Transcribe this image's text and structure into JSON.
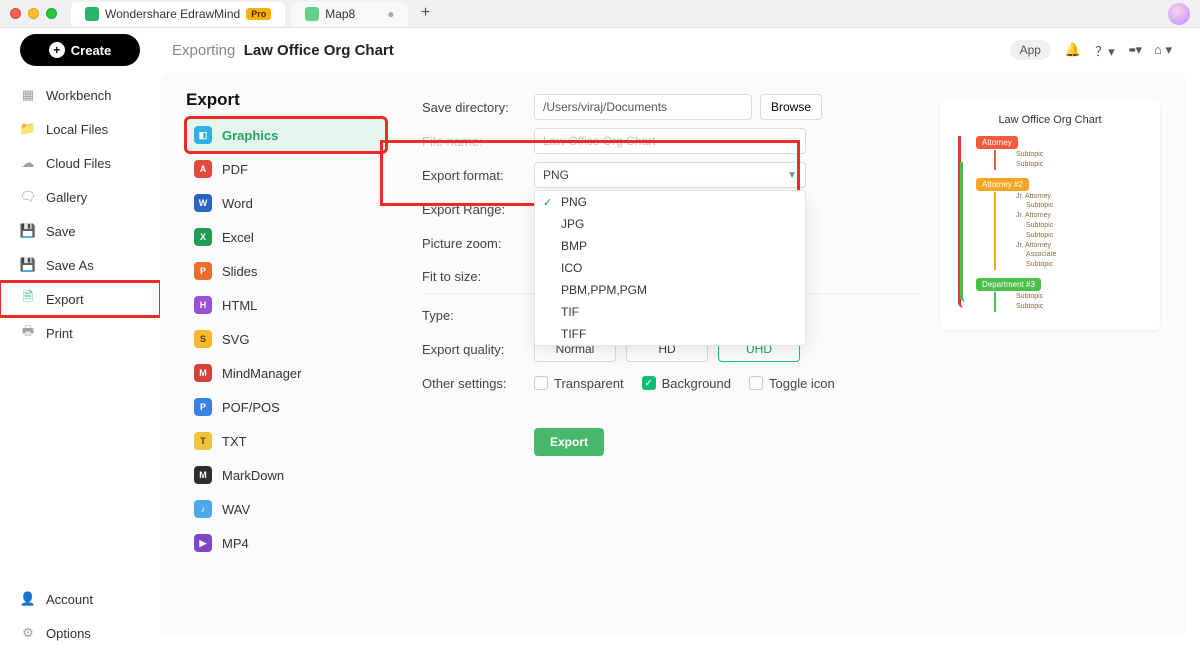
{
  "titlebar": {
    "app_name": "Wondershare EdrawMind",
    "badge": "Pro",
    "tab2": "Map8"
  },
  "header": {
    "create": "Create",
    "crumb_prefix": "Exporting",
    "crumb_title": "Law Office Org Chart",
    "app_chip": "App"
  },
  "nav": {
    "workbench": "Workbench",
    "localfiles": "Local Files",
    "cloudfiles": "Cloud Files",
    "gallery": "Gallery",
    "save": "Save",
    "saveas": "Save As",
    "export": "Export",
    "print": "Print",
    "account": "Account",
    "options": "Options"
  },
  "export": {
    "heading": "Export",
    "formats": {
      "graphics": "Graphics",
      "pdf": "PDF",
      "word": "Word",
      "excel": "Excel",
      "slides": "Slides",
      "html": "HTML",
      "svg": "SVG",
      "mindmanager": "MindManager",
      "pofpos": "POF/POS",
      "txt": "TXT",
      "markdown": "MarkDown",
      "wav": "WAV",
      "mp4": "MP4"
    }
  },
  "form": {
    "save_dir_label": "Save directory:",
    "save_dir_value": "/Users/viraj/Documents",
    "browse": "Browse",
    "file_name_label": "File name:",
    "file_name_value": "Law Office Org Chart",
    "export_format_label": "Export format:",
    "export_format_value": "PNG",
    "format_options": [
      "PNG",
      "JPG",
      "BMP",
      "ICO",
      "PBM,PPM,PGM",
      "TIF",
      "TIFF"
    ],
    "export_range_label": "Export Range:",
    "picture_zoom_label": "Picture zoom:",
    "fit_to_size_label": "Fit to size:",
    "type_label": "Type:",
    "quality_label": "Export quality:",
    "quality_options": [
      "Normal",
      "HD",
      "UHD"
    ],
    "other_settings_label": "Other settings:",
    "transparent": "Transparent",
    "background": "Background",
    "toggle_icon": "Toggle icon",
    "export_btn": "Export"
  },
  "preview": {
    "title": "Law Office Org Chart",
    "nodes": {
      "n1": "Attorney",
      "n2": "Attorney #2",
      "n3": "Department #3",
      "sub": "Subtopic",
      "jr": "Jr. Attorney",
      "assoc": "Associate"
    }
  }
}
